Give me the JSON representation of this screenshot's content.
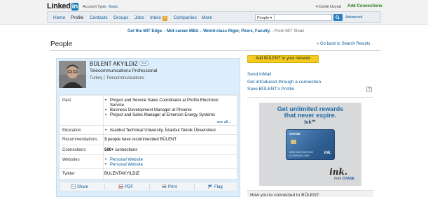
{
  "header": {
    "logo_text": "Linked",
    "logo_in": "in",
    "account_label": "Account Type:",
    "account_type": "Basic",
    "user_name": "Cemil Ozyurt",
    "add_connections": "Add Connections"
  },
  "nav": {
    "items": [
      {
        "label": "Home"
      },
      {
        "label": "Profile"
      },
      {
        "label": "Contacts"
      },
      {
        "label": "Groups"
      },
      {
        "label": "Jobs"
      },
      {
        "label": "Inbox"
      },
      {
        "label": "Companies"
      },
      {
        "label": "More"
      }
    ],
    "inbox_count": "3",
    "search_scope": "People",
    "search_value": "",
    "advanced": "Advanced"
  },
  "ad_line": {
    "bold": "Get the MIT Edge. - Mid-career MBA – World-class Rigor, Peers, Faculty.",
    "source": " - From MIT Sloan"
  },
  "page": {
    "title": "People",
    "back_link": "« Go back to Search Results"
  },
  "profile": {
    "name": "BÜLENT AKYILDIZ",
    "degree": "2nd",
    "headline": "Telecommunications Professional",
    "location": "Turkey",
    "industry": "Telecommunications",
    "past_label": "Past",
    "past": [
      "Project and Service Sales Coordinator at Profilo Electronic Service",
      "Business Development Manager at Phoenix",
      "Project and Sales Manager at Emerson Energy Systems"
    ],
    "see_all": "see all...",
    "education_label": "Education",
    "education": "Istanbul Technical University, İstanbul Teknik Üniversitesi",
    "recommendations_label": "Recommendations",
    "recommendations_count": "3",
    "recommendations_text": " people have recommended BÜLENT",
    "connections_label": "Connections",
    "connections_count": "500+",
    "connections_text": " connections",
    "websites_label": "Websites",
    "websites": [
      "Personal Website",
      "Personal Website"
    ],
    "twitter_label": "Twitter",
    "twitter": "BULENTAKYILDIZ"
  },
  "actions": {
    "share": "Share",
    "pdf": "PDF",
    "print": "Print",
    "flag": "Flag"
  },
  "sidebar": {
    "add_button": "Add BÜLENT to your network",
    "send_inmail": "Send InMail",
    "get_intro": "Get introduced through a connection",
    "save_profile": "Save BÜLENT's Profile",
    "help": "?",
    "how_connected": "How you're connected to BÜLENT"
  },
  "ad": {
    "headline1": "Get unlimited rewards",
    "headline2": "that never expire.",
    "ink": "Ink℠",
    "card_brand": "CHASE",
    "card_number": "0000 0000 0000 0000",
    "card_name": "A. KARDHOLDER",
    "card_ink": "ink.",
    "signature": "ink.",
    "from": "from ",
    "from_brand": "CHASE"
  }
}
